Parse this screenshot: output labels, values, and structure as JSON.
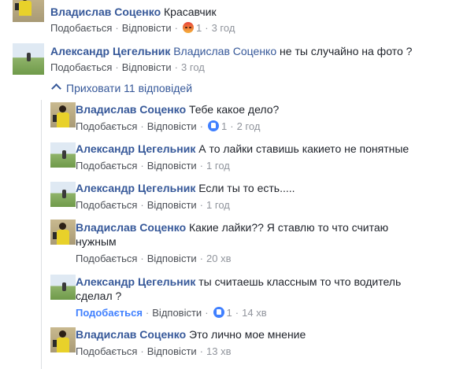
{
  "actions": {
    "like": "Подобається",
    "reply": "Відповісти",
    "sep": "·"
  },
  "hide_replies": "Приховати 11 відповідей",
  "comments": [
    {
      "author": "Владислав Соценко",
      "text": "Красавчик",
      "reaction": "angry-icon",
      "reaction_count": "1",
      "time": "3 год"
    },
    {
      "author": "Александр Цегельник",
      "mention": "Владислав Соценко",
      "text": "не ты случайно на фото ?",
      "time": "3 год"
    }
  ],
  "replies": [
    {
      "author": "Владислав Соценко",
      "text": "Тебе какое дело?",
      "reaction": "like-icon",
      "reaction_count": "1",
      "time": "2 год"
    },
    {
      "author": "Александр Цегельник",
      "text": "А то лайки ставишь какието не понятные",
      "time": "1 год"
    },
    {
      "author": "Александр Цегельник",
      "text": "Если ты то есть.....",
      "time": "1 год"
    },
    {
      "author": "Владислав Соценко",
      "text": "Какие лайки?? Я ставлю то что считаю",
      "text2": "нужным",
      "time": "20 хв"
    },
    {
      "author": "Александр Цегельник",
      "text": "ты считаешь классным то что водитель",
      "text2": "сделал ?",
      "liked": true,
      "reaction": "like-icon",
      "reaction_count": "1",
      "time": "14 хв"
    },
    {
      "author": "Владислав Соценко",
      "text": "Это лично мое мнение",
      "time": "13 хв"
    }
  ]
}
